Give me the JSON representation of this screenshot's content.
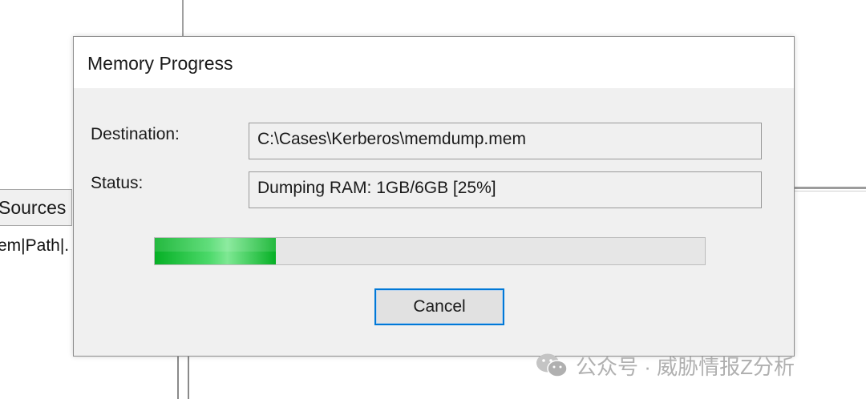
{
  "background": {
    "tab_label": "Sources",
    "row_text": "em|Path|."
  },
  "dialog": {
    "title": "Memory Progress",
    "destination_label": "Destination:",
    "destination_value": "C:\\Cases\\Kerberos\\memdump.mem",
    "status_label": "Status:",
    "status_value": "Dumping RAM: 1GB/6GB [25%]",
    "progress_fraction": 0.22,
    "cancel_label": "Cancel"
  },
  "watermark": {
    "text": "公众号 · 威胁情报Z分析",
    "icon": "wechat-icon"
  },
  "colors": {
    "progress_green": "#06b025",
    "focus_blue": "#0078d7",
    "dialog_bg": "#f0f0f0"
  }
}
